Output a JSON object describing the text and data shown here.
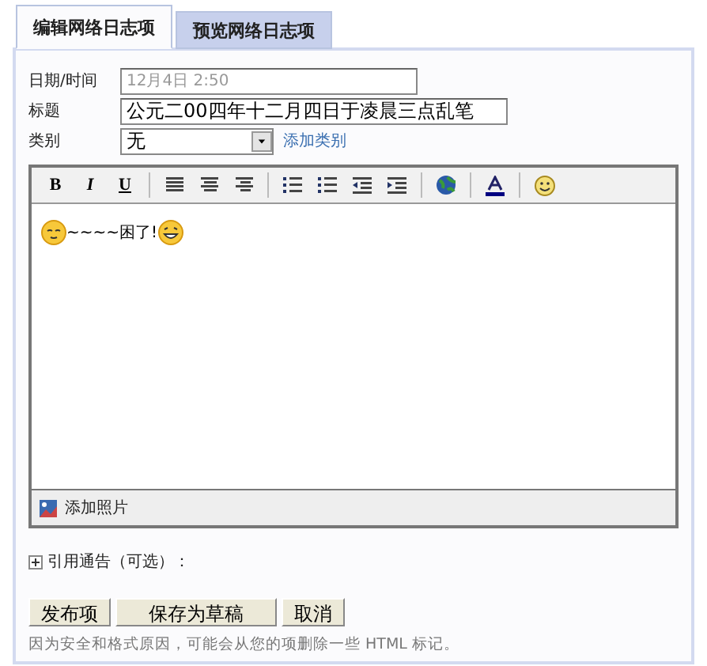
{
  "tabs": [
    {
      "label": "编辑网络日志项",
      "selected": true
    },
    {
      "label": "预览网络日志项",
      "selected": false
    }
  ],
  "form": {
    "fields": [
      {
        "kind": "readonly",
        "label": "日期/时间",
        "value": "12月4日 2:50",
        "disabled": true
      },
      {
        "kind": "text",
        "label": "标题",
        "value": "公元二00四年十二月四日于凌晨三点乱笔"
      },
      {
        "kind": "select",
        "label": "类别",
        "value": "无",
        "link": "添加类别"
      }
    ]
  },
  "editor": {
    "toolbar": [
      {
        "kind": "bold",
        "label": "B"
      },
      {
        "kind": "italic",
        "label": "I"
      },
      {
        "kind": "underline",
        "label": "U"
      },
      {
        "kind": "sep"
      },
      {
        "kind": "align-left"
      },
      {
        "kind": "align-center"
      },
      {
        "kind": "align-right"
      },
      {
        "kind": "sep"
      },
      {
        "kind": "ordered-list"
      },
      {
        "kind": "bullet-list"
      },
      {
        "kind": "outdent"
      },
      {
        "kind": "indent"
      },
      {
        "kind": "sep"
      },
      {
        "kind": "globe"
      },
      {
        "kind": "sep"
      },
      {
        "kind": "font-color"
      },
      {
        "kind": "sep"
      },
      {
        "kind": "smiley"
      }
    ],
    "content": "~~~~困了!",
    "footer": "添加照片"
  },
  "trackback": {
    "label": "引用通告（可选）：",
    "expanded": false
  },
  "buttons": [
    "发布项",
    "保存为草稿",
    "取消"
  ],
  "note": "因为安全和格式原因，可能会从您的项删除一些 HTML 标记。"
}
